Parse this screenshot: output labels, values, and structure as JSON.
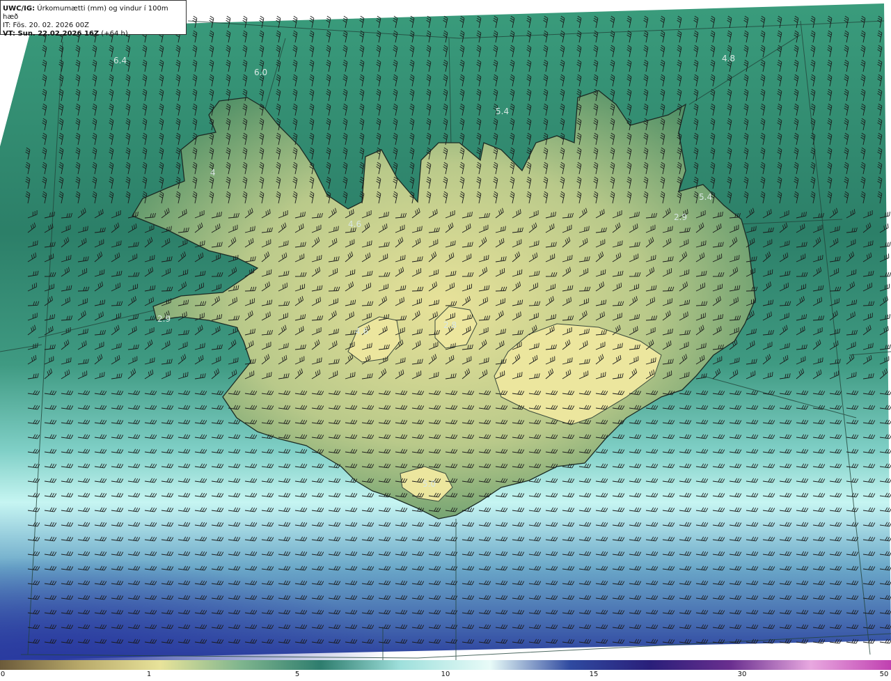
{
  "header": {
    "product": "UWC/IG:",
    "title": " Úrkomumætti (mm) og vindur í 100m hæð",
    "init_time": "IT: Fös. 20. 02. 2026 00Z",
    "valid_prefix": "VT: Sun. 22.02.2026 16Z",
    "valid_suffix": " (+64 h)"
  },
  "value_labels": [
    {
      "text": "6.4"
    },
    {
      "text": "6.0"
    },
    {
      "text": "5.4"
    },
    {
      "text": "4.8"
    },
    {
      "text": "4.6"
    },
    {
      "text": "5.4"
    },
    {
      "text": "2.9"
    },
    {
      "text": "2.9"
    },
    {
      "text": "4.6"
    },
    {
      "text": "5.0"
    },
    {
      "text": "4"
    },
    {
      "text": "2.8"
    }
  ],
  "colorbar": {
    "ticks": [
      "0",
      "1",
      "5",
      "10",
      "15",
      "30",
      "50"
    ],
    "colors": [
      "#6b5a3a",
      "#b8a96a",
      "#e8e39a",
      "#7fb58e",
      "#2e7d6e",
      "#9fe0dc",
      "#e8fbf8",
      "#2f4aa0",
      "#2a1f7a",
      "#6a2f8f",
      "#e8a8e0",
      "#c040b0"
    ]
  },
  "map_colors": {
    "ocean_north": "#2f8a72",
    "ocean_mid": "#3d9a80",
    "ocean_south_light": "#a9eaea",
    "ocean_south_deep": "#2b46a8",
    "land_low": "#5a9a6c",
    "land_high": "#e4e08e"
  }
}
